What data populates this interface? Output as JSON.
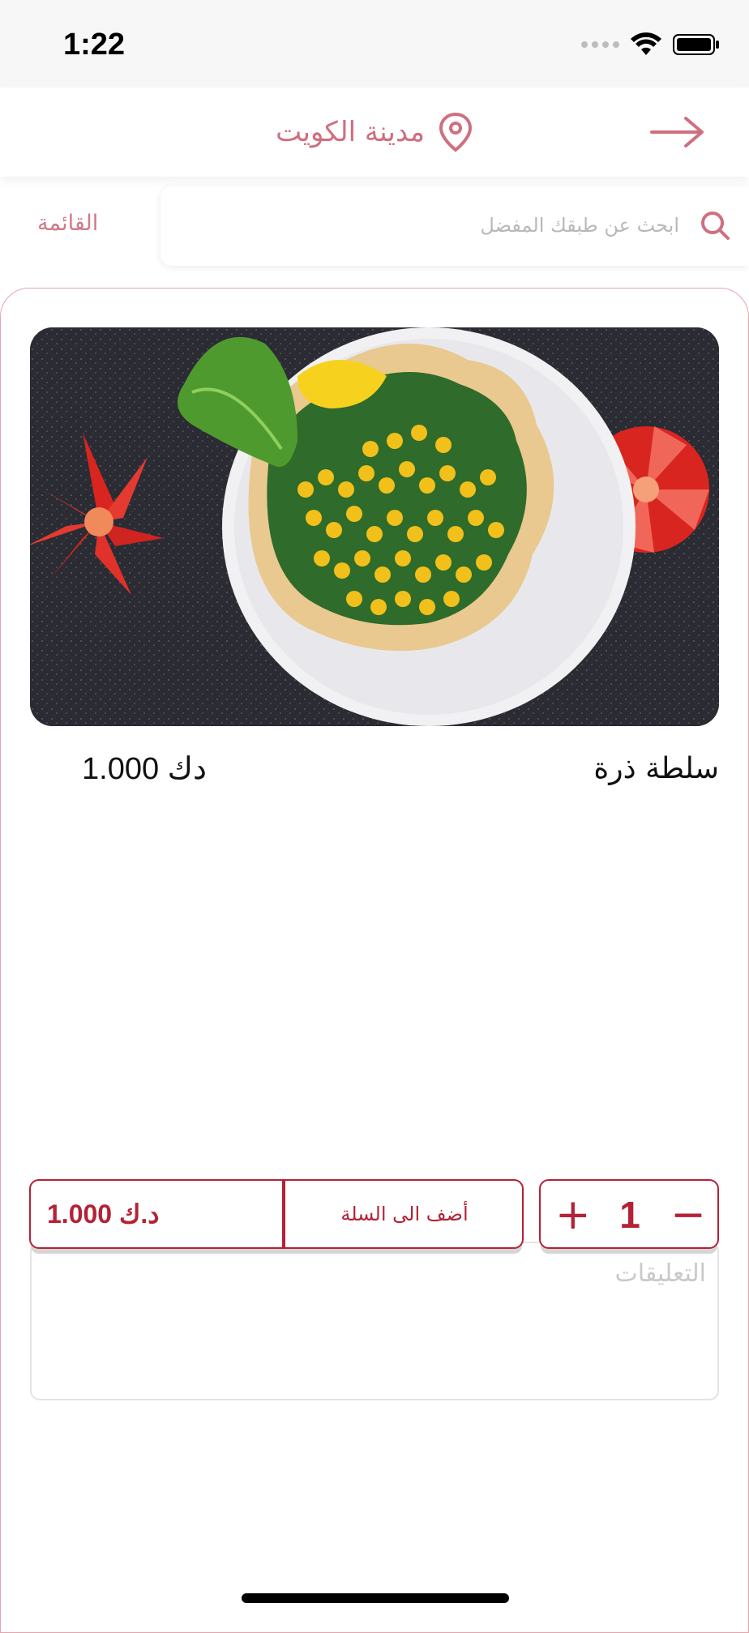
{
  "status_bar": {
    "time": "1:22"
  },
  "header": {
    "location": "مدينة الكويت",
    "back_icon": "arrow-right-icon",
    "location_icon": "map-pin-icon"
  },
  "search": {
    "menu_label": "القائمة",
    "placeholder": "ابحث عن طبقك المفضل",
    "icon": "search-icon"
  },
  "dish": {
    "name": "سلطة ذرة",
    "price": "1.000 دك",
    "image_alt": "سلطة ذرة"
  },
  "comments": {
    "placeholder": "التعليقات"
  },
  "cart": {
    "add_label": "أضف الى السلة",
    "total": "د.ك 1.000"
  },
  "quantity": {
    "value": "1",
    "plus": "+",
    "minus": "−"
  },
  "colors": {
    "accent": "#b32236",
    "soft_accent": "#cf6f7f"
  }
}
